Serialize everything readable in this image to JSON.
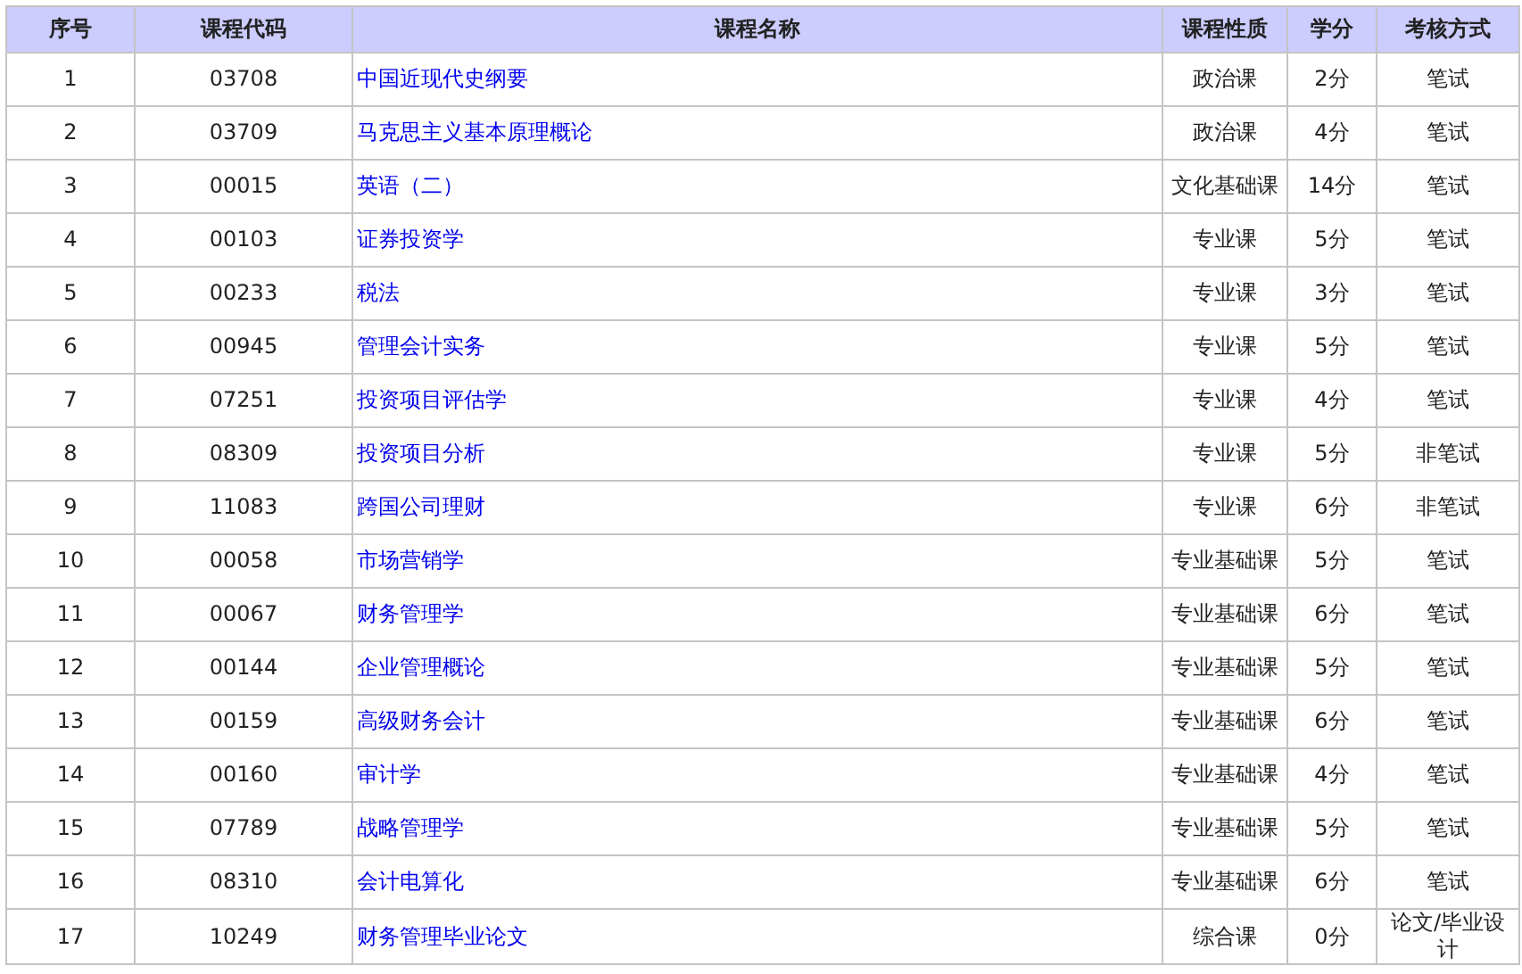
{
  "table": {
    "columns": [
      "序号",
      "课程代码",
      "课程名称",
      "课程性质",
      "学分",
      "考核方式"
    ],
    "rows": [
      {
        "no": "1",
        "code": "03708",
        "name": "中国近现代史纲要",
        "type": "政治课",
        "credits": "2分",
        "exam": "笔试"
      },
      {
        "no": "2",
        "code": "03709",
        "name": "马克思主义基本原理概论",
        "type": "政治课",
        "credits": "4分",
        "exam": "笔试"
      },
      {
        "no": "3",
        "code": "00015",
        "name": "英语（二）",
        "type": "文化基础课",
        "credits": "14分",
        "exam": "笔试"
      },
      {
        "no": "4",
        "code": "00103",
        "name": "证券投资学",
        "type": "专业课",
        "credits": "5分",
        "exam": "笔试"
      },
      {
        "no": "5",
        "code": "00233",
        "name": "税法",
        "type": "专业课",
        "credits": "3分",
        "exam": "笔试"
      },
      {
        "no": "6",
        "code": "00945",
        "name": "管理会计实务",
        "type": "专业课",
        "credits": "5分",
        "exam": "笔试"
      },
      {
        "no": "7",
        "code": "07251",
        "name": "投资项目评估学",
        "type": "专业课",
        "credits": "4分",
        "exam": "笔试"
      },
      {
        "no": "8",
        "code": "08309",
        "name": "投资项目分析",
        "type": "专业课",
        "credits": "5分",
        "exam": "非笔试"
      },
      {
        "no": "9",
        "code": "11083",
        "name": "跨国公司理财",
        "type": "专业课",
        "credits": "6分",
        "exam": "非笔试"
      },
      {
        "no": "10",
        "code": "00058",
        "name": "市场营销学",
        "type": "专业基础课",
        "credits": "5分",
        "exam": "笔试"
      },
      {
        "no": "11",
        "code": "00067",
        "name": "财务管理学",
        "type": "专业基础课",
        "credits": "6分",
        "exam": "笔试"
      },
      {
        "no": "12",
        "code": "00144",
        "name": "企业管理概论",
        "type": "专业基础课",
        "credits": "5分",
        "exam": "笔试"
      },
      {
        "no": "13",
        "code": "00159",
        "name": "高级财务会计",
        "type": "专业基础课",
        "credits": "6分",
        "exam": "笔试"
      },
      {
        "no": "14",
        "code": "00160",
        "name": "审计学",
        "type": "专业基础课",
        "credits": "4分",
        "exam": "笔试"
      },
      {
        "no": "15",
        "code": "07789",
        "name": "战略管理学",
        "type": "专业基础课",
        "credits": "5分",
        "exam": "笔试"
      },
      {
        "no": "16",
        "code": "08310",
        "name": "会计电算化",
        "type": "专业基础课",
        "credits": "6分",
        "exam": "笔试"
      },
      {
        "no": "17",
        "code": "10249",
        "name": "财务管理毕业论文",
        "type": "综合课",
        "credits": "0分",
        "exam": "论文/毕业设计"
      }
    ]
  }
}
